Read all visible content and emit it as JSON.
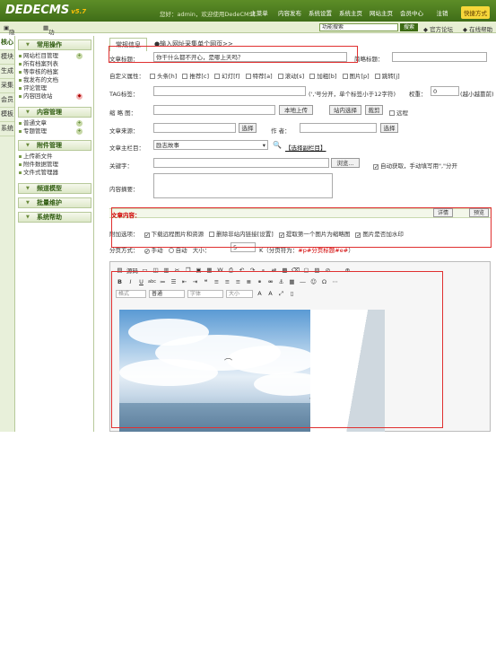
{
  "app": {
    "logo": "DEDECMS",
    "version": "v5.7",
    "welcome": "您好：admin，欢迎使用DedeCMS！",
    "topnav": [
      "主菜单",
      "内容发布",
      "系统设置",
      "系统主页",
      "网站主页",
      "会员中心",
      "注销"
    ],
    "quick": "快捷方式"
  },
  "subbar": {
    "hide_menu": "隐藏菜单",
    "function_map": "功能地图",
    "search_placeholder": "功能搜索",
    "search_button": "搜索",
    "official_forum": "官方论坛",
    "help": "在线帮助"
  },
  "left_tabs": [
    "核心",
    "模块",
    "生成",
    "采集",
    "会员",
    "模板",
    "系统"
  ],
  "menu": {
    "common": {
      "title": "常用操作",
      "items": [
        "网站栏目管理",
        "所有档案列表",
        "等审核的档案",
        "我发布的文档",
        "评论管理",
        "内容回收站"
      ]
    },
    "content": {
      "title": "内容管理",
      "items": [
        "普通文章",
        "专题管理"
      ]
    },
    "attach": {
      "title": "附件管理",
      "items": [
        "上传新文件",
        "附件数据管理",
        "文件式管理器"
      ]
    },
    "channel": {
      "title": "频道模型"
    },
    "batch": {
      "title": "批量维护"
    },
    "sys": {
      "title": "系统帮助"
    }
  },
  "tabs": [
    "常规信息",
    "●输入网址采集单个网页>>"
  ],
  "form": {
    "title_label": "文章标题：",
    "title_value": "你干什么都不开心，是哪上天吗？",
    "short_title_label": "简略标题：",
    "flags_label": "自定义属性：",
    "flags": [
      "头条[h]",
      "推荐[c]",
      "幻灯[f]",
      "特荐[a]",
      "滚动[s]",
      "加粗[b]",
      "图片[p]",
      "跳转[j]"
    ],
    "tag_label": "TAG标签：",
    "tag_hint": "(','号分开，单个标签小于12字符)",
    "weight_label": "权重：",
    "weight_value": "0",
    "weight_hint": "(越小越靠前)",
    "thumb_label": "缩 略 图：",
    "upload_btn": "本地上传",
    "site_select_btn": "站内选择",
    "crop_btn": "裁剪",
    "remote_label": "远程",
    "source_label": "文章来源：",
    "select_btn": "选择",
    "author_label": "作 者：",
    "select_btn2": "选择",
    "column_label": "文章主栏目：",
    "column_value": "励志故事",
    "subcolumn_link": "【选择副栏目】",
    "keywords_label": "关键字：",
    "browse_btn": "浏览...",
    "auto_get_label": "自动获取，手动填写用\",\"分开",
    "summary_label": "内容摘要：",
    "body_label": "文章内容：",
    "tab_article": "详情",
    "tab_preview": "预览",
    "extra_label": "附加选项：",
    "extra_opts": [
      "下载远程图片和资源",
      "删除非站内链接[设置]",
      "提取第一个图片为缩略图",
      "图片是否加水印"
    ],
    "paging_label": "分页方式：",
    "manual": "手动",
    "auto": "自动",
    "size_label": "大小：",
    "size_value": "5",
    "size_hint": "K（分页符为：",
    "pager": "#p#分页标题#e#",
    "size_hint_end": "）"
  },
  "editor": {
    "source": "源码",
    "format_opts": [
      "格式",
      "普通",
      "字体",
      "大小"
    ]
  }
}
